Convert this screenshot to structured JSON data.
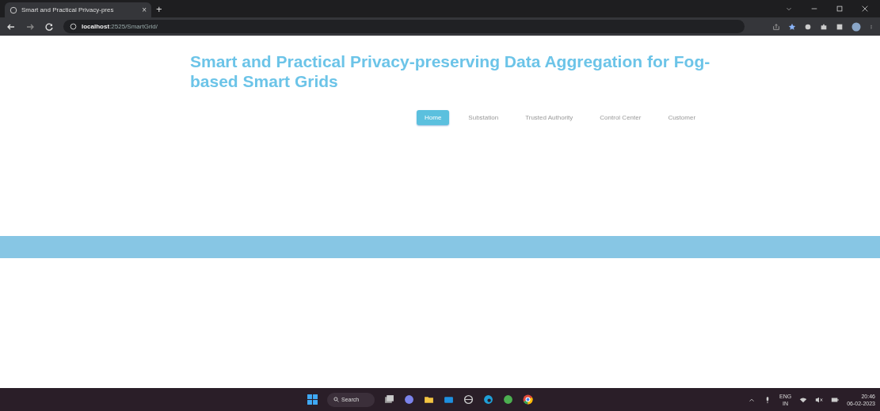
{
  "browser": {
    "tab_title": "Smart and Practical Privacy-pres",
    "tab_close": "×",
    "new_tab": "+",
    "url_host": "localhost",
    "url_path": ":2525/SmartGrid/"
  },
  "page": {
    "title": "Smart and Practical Privacy-preserving Data Aggregation for Fog-based Smart Grids",
    "nav": [
      {
        "label": "Home",
        "selected": true
      },
      {
        "label": "Substation",
        "selected": false
      },
      {
        "label": "Trusted Authority",
        "selected": false
      },
      {
        "label": "Control Center",
        "selected": false
      },
      {
        "label": "Customer",
        "selected": false
      }
    ]
  },
  "taskbar": {
    "search": "Search",
    "language": "ENG",
    "region": "IN",
    "time": "20:46",
    "date": "06-02-2023"
  }
}
